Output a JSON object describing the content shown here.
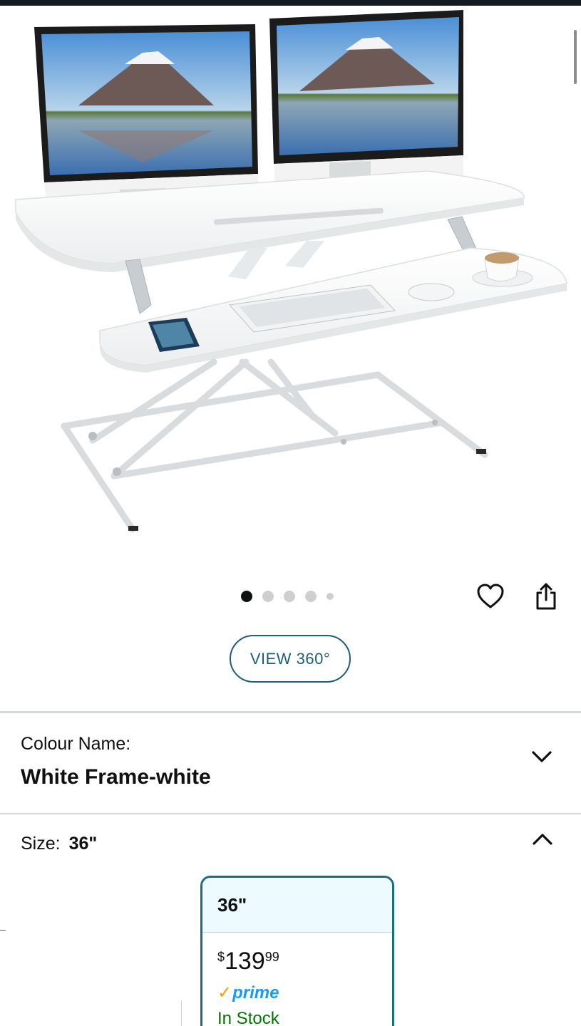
{
  "gallery": {
    "dots_total": 5,
    "active_index": 0
  },
  "actions": {
    "wishlist_icon": "heart-icon",
    "share_icon": "share-icon",
    "view360_label": "VIEW 360°"
  },
  "colour": {
    "label": "Colour Name:",
    "value": "White Frame-white",
    "toggle_icon": "chevron-down-icon"
  },
  "size": {
    "label": "Size:",
    "value": "36\"",
    "toggle_icon": "chevron-up-icon",
    "options": [
      {
        "name": "36\"",
        "price_symbol": "$",
        "price_whole": "139",
        "price_fraction": "99",
        "badge": "prime",
        "availability": "In Stock",
        "selected": true
      }
    ]
  },
  "colors": {
    "accent": "#1f5e79",
    "selected_border": "#1b6d7e",
    "prime_blue": "#1a98ff",
    "in_stock_green": "#007600"
  }
}
